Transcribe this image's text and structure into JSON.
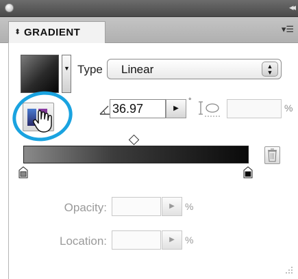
{
  "panel": {
    "title": "GRADIENT",
    "tab_arrows": "⬍",
    "menu_icon": "panel-menu-icon",
    "collapse_icon": "collapse-panel-icon"
  },
  "type": {
    "label": "Type",
    "value": "Linear"
  },
  "angle": {
    "value": "36.97",
    "unit": "°"
  },
  "aspect": {
    "value": "",
    "unit": "%"
  },
  "opacity": {
    "label": "Opacity:",
    "value": "",
    "unit": "%"
  },
  "location": {
    "label": "Location:",
    "value": "",
    "unit": "%"
  },
  "gradient": {
    "start_color": "#8a8a8a",
    "end_color": "#0a0a0a"
  },
  "colors": {
    "highlight": "#1aa3e0"
  }
}
